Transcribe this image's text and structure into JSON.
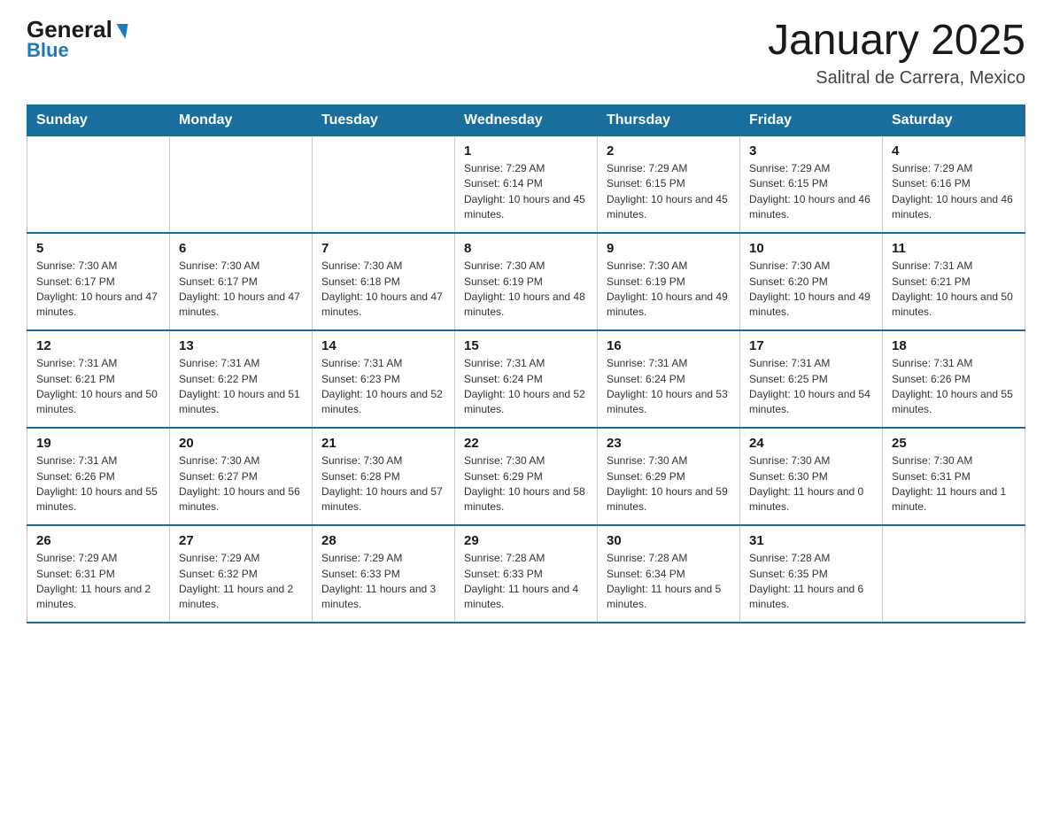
{
  "header": {
    "logo_line1": "General",
    "logo_line2": "Blue",
    "title": "January 2025",
    "subtitle": "Salitral de Carrera, Mexico"
  },
  "days_of_week": [
    "Sunday",
    "Monday",
    "Tuesday",
    "Wednesday",
    "Thursday",
    "Friday",
    "Saturday"
  ],
  "weeks": [
    [
      {
        "day": "",
        "info": ""
      },
      {
        "day": "",
        "info": ""
      },
      {
        "day": "",
        "info": ""
      },
      {
        "day": "1",
        "info": "Sunrise: 7:29 AM\nSunset: 6:14 PM\nDaylight: 10 hours and 45 minutes."
      },
      {
        "day": "2",
        "info": "Sunrise: 7:29 AM\nSunset: 6:15 PM\nDaylight: 10 hours and 45 minutes."
      },
      {
        "day": "3",
        "info": "Sunrise: 7:29 AM\nSunset: 6:15 PM\nDaylight: 10 hours and 46 minutes."
      },
      {
        "day": "4",
        "info": "Sunrise: 7:29 AM\nSunset: 6:16 PM\nDaylight: 10 hours and 46 minutes."
      }
    ],
    [
      {
        "day": "5",
        "info": "Sunrise: 7:30 AM\nSunset: 6:17 PM\nDaylight: 10 hours and 47 minutes."
      },
      {
        "day": "6",
        "info": "Sunrise: 7:30 AM\nSunset: 6:17 PM\nDaylight: 10 hours and 47 minutes."
      },
      {
        "day": "7",
        "info": "Sunrise: 7:30 AM\nSunset: 6:18 PM\nDaylight: 10 hours and 47 minutes."
      },
      {
        "day": "8",
        "info": "Sunrise: 7:30 AM\nSunset: 6:19 PM\nDaylight: 10 hours and 48 minutes."
      },
      {
        "day": "9",
        "info": "Sunrise: 7:30 AM\nSunset: 6:19 PM\nDaylight: 10 hours and 49 minutes."
      },
      {
        "day": "10",
        "info": "Sunrise: 7:30 AM\nSunset: 6:20 PM\nDaylight: 10 hours and 49 minutes."
      },
      {
        "day": "11",
        "info": "Sunrise: 7:31 AM\nSunset: 6:21 PM\nDaylight: 10 hours and 50 minutes."
      }
    ],
    [
      {
        "day": "12",
        "info": "Sunrise: 7:31 AM\nSunset: 6:21 PM\nDaylight: 10 hours and 50 minutes."
      },
      {
        "day": "13",
        "info": "Sunrise: 7:31 AM\nSunset: 6:22 PM\nDaylight: 10 hours and 51 minutes."
      },
      {
        "day": "14",
        "info": "Sunrise: 7:31 AM\nSunset: 6:23 PM\nDaylight: 10 hours and 52 minutes."
      },
      {
        "day": "15",
        "info": "Sunrise: 7:31 AM\nSunset: 6:24 PM\nDaylight: 10 hours and 52 minutes."
      },
      {
        "day": "16",
        "info": "Sunrise: 7:31 AM\nSunset: 6:24 PM\nDaylight: 10 hours and 53 minutes."
      },
      {
        "day": "17",
        "info": "Sunrise: 7:31 AM\nSunset: 6:25 PM\nDaylight: 10 hours and 54 minutes."
      },
      {
        "day": "18",
        "info": "Sunrise: 7:31 AM\nSunset: 6:26 PM\nDaylight: 10 hours and 55 minutes."
      }
    ],
    [
      {
        "day": "19",
        "info": "Sunrise: 7:31 AM\nSunset: 6:26 PM\nDaylight: 10 hours and 55 minutes."
      },
      {
        "day": "20",
        "info": "Sunrise: 7:30 AM\nSunset: 6:27 PM\nDaylight: 10 hours and 56 minutes."
      },
      {
        "day": "21",
        "info": "Sunrise: 7:30 AM\nSunset: 6:28 PM\nDaylight: 10 hours and 57 minutes."
      },
      {
        "day": "22",
        "info": "Sunrise: 7:30 AM\nSunset: 6:29 PM\nDaylight: 10 hours and 58 minutes."
      },
      {
        "day": "23",
        "info": "Sunrise: 7:30 AM\nSunset: 6:29 PM\nDaylight: 10 hours and 59 minutes."
      },
      {
        "day": "24",
        "info": "Sunrise: 7:30 AM\nSunset: 6:30 PM\nDaylight: 11 hours and 0 minutes."
      },
      {
        "day": "25",
        "info": "Sunrise: 7:30 AM\nSunset: 6:31 PM\nDaylight: 11 hours and 1 minute."
      }
    ],
    [
      {
        "day": "26",
        "info": "Sunrise: 7:29 AM\nSunset: 6:31 PM\nDaylight: 11 hours and 2 minutes."
      },
      {
        "day": "27",
        "info": "Sunrise: 7:29 AM\nSunset: 6:32 PM\nDaylight: 11 hours and 2 minutes."
      },
      {
        "day": "28",
        "info": "Sunrise: 7:29 AM\nSunset: 6:33 PM\nDaylight: 11 hours and 3 minutes."
      },
      {
        "day": "29",
        "info": "Sunrise: 7:28 AM\nSunset: 6:33 PM\nDaylight: 11 hours and 4 minutes."
      },
      {
        "day": "30",
        "info": "Sunrise: 7:28 AM\nSunset: 6:34 PM\nDaylight: 11 hours and 5 minutes."
      },
      {
        "day": "31",
        "info": "Sunrise: 7:28 AM\nSunset: 6:35 PM\nDaylight: 11 hours and 6 minutes."
      },
      {
        "day": "",
        "info": ""
      }
    ]
  ]
}
